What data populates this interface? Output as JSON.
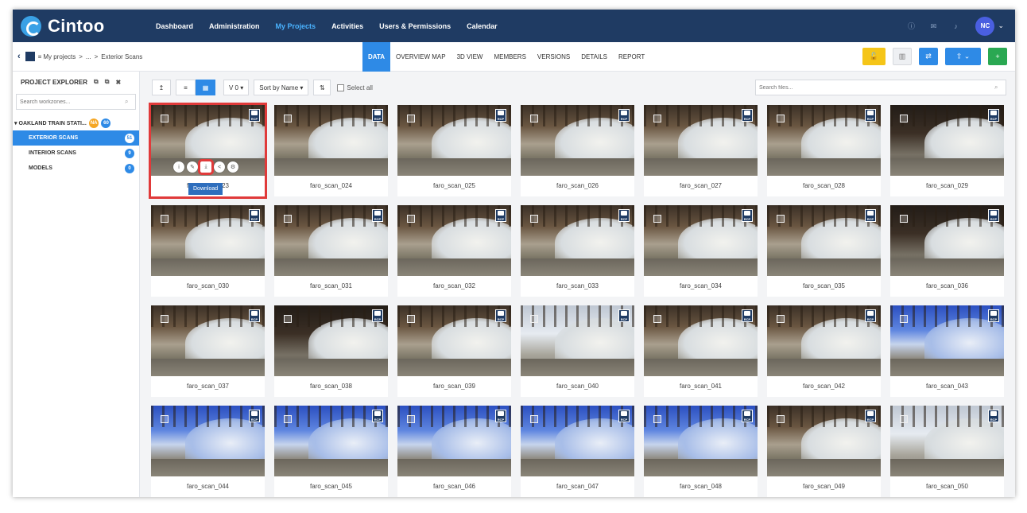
{
  "app": {
    "name": "Cintoo"
  },
  "nav": [
    "Dashboard",
    "Administration",
    "My Projects",
    "Activities",
    "Users & Permissions",
    "Calendar"
  ],
  "nav_active": "My Projects",
  "user": {
    "initials": "NC"
  },
  "breadcrumb": {
    "root": "My projects",
    "sep1": ">",
    "ellipsis": "...",
    "sep2": ">",
    "current": "Exterior Scans"
  },
  "tabs": [
    "DATA",
    "OVERVIEW MAP",
    "3D VIEW",
    "MEMBERS",
    "VERSIONS",
    "DETAILS",
    "REPORT"
  ],
  "tab_active": "DATA",
  "sidebar": {
    "title": "PROJECT EXPLORER",
    "search_placeholder": "Search workzones...",
    "root": {
      "label": "OAKLAND TRAIN STATI...",
      "badge1": "NA",
      "badge2": "60"
    },
    "items": [
      {
        "label": "EXTERIOR SCANS",
        "count": "51"
      },
      {
        "label": "INTERIOR SCANS",
        "count": "9"
      },
      {
        "label": "MODELS",
        "count": "0"
      }
    ]
  },
  "toolbar": {
    "version": "V 0 ▾",
    "sort": "Sort by Name ▾",
    "select_all": "Select all",
    "search_placeholder": "Search files..."
  },
  "tooltip": "Download",
  "rcp_label": "RCP",
  "scans": [
    "faro_scan_023",
    "faro_scan_024",
    "faro_scan_025",
    "faro_scan_026",
    "faro_scan_027",
    "faro_scan_028",
    "faro_scan_029",
    "faro_scan_030",
    "faro_scan_031",
    "faro_scan_032",
    "faro_scan_033",
    "faro_scan_034",
    "faro_scan_035",
    "faro_scan_036",
    "faro_scan_037",
    "faro_scan_038",
    "faro_scan_039",
    "faro_scan_040",
    "faro_scan_041",
    "faro_scan_042",
    "faro_scan_043",
    "faro_scan_044",
    "faro_scan_045",
    "faro_scan_046",
    "faro_scan_047",
    "faro_scan_048",
    "faro_scan_049",
    "faro_scan_050"
  ],
  "card0_visible_name_suffix": "3"
}
